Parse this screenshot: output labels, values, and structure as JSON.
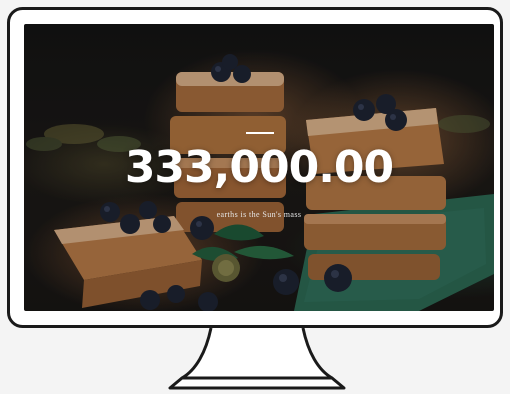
{
  "hero": {
    "value": "333,000.00",
    "caption": "earths is the Sun's mass"
  },
  "colors": {
    "frame": "#1a1a1a",
    "screen_bg": "#141414",
    "crust": "#b67a48",
    "blueberry": "#1e2433",
    "cloth": "#2f6b55",
    "text": "#ffffff"
  },
  "icons": {
    "device": "desktop-monitor-icon"
  }
}
